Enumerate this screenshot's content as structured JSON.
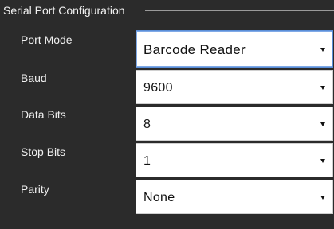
{
  "panel": {
    "title": "Serial Port Configuration"
  },
  "fields": [
    {
      "label": "Port Mode",
      "value": "Barcode Reader",
      "icon": "chevron-down-icon"
    },
    {
      "label": "Baud",
      "value": "9600",
      "icon": "chevron-down-icon"
    },
    {
      "label": "Data Bits",
      "value": "8",
      "icon": "chevron-down-icon"
    },
    {
      "label": "Stop Bits",
      "value": "1",
      "icon": "chevron-down-icon"
    },
    {
      "label": "Parity",
      "value": "None",
      "icon": "chevron-down-icon"
    }
  ],
  "colors": {
    "panel_background": "#2b2b2b",
    "text": "#f0f0f0",
    "select_background": "#ffffff",
    "focus_border": "#5b8fd8"
  }
}
